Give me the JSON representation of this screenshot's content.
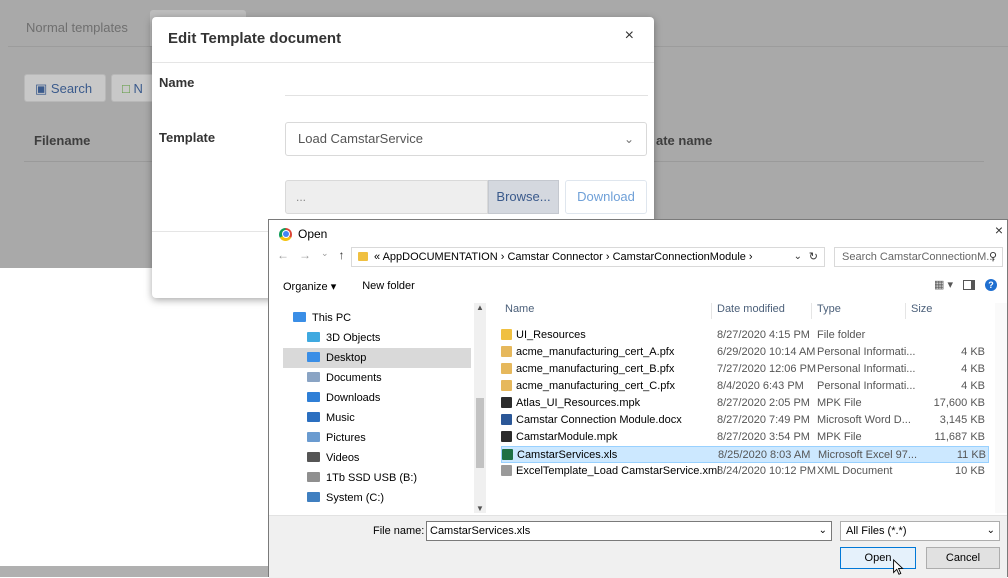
{
  "background": {
    "tabs": [
      "Normal templates",
      ""
    ],
    "search_label": "Search",
    "new_label": "N",
    "col_filename": "Filename",
    "col_template_name": "ate name"
  },
  "modal": {
    "title": "Edit Template document",
    "close": "×",
    "name_label": "Name",
    "template_label": "Template",
    "template_value": "Load CamstarService",
    "file_placeholder": "...",
    "browse_label": "Browse...",
    "download_label": "Download"
  },
  "open_dialog": {
    "title": "Open",
    "close": "×",
    "path": "« AppDOCUMENTATION › Camstar Connector › CamstarConnectionModule ›",
    "search_placeholder": "Search CamstarConnectionM...",
    "organize_label": "Organize ▾",
    "new_folder_label": "New folder",
    "nav_items": [
      {
        "label": "This PC",
        "icon": "computer-icon",
        "color": "#3a8ee6"
      },
      {
        "label": "3D Objects",
        "icon": "cube-icon",
        "color": "#3fa9e0"
      },
      {
        "label": "Desktop",
        "icon": "desktop-icon",
        "color": "#3a8ee6"
      },
      {
        "label": "Documents",
        "icon": "documents-icon",
        "color": "#8aa4c4"
      },
      {
        "label": "Downloads",
        "icon": "download-icon",
        "color": "#2f7fd6"
      },
      {
        "label": "Music",
        "icon": "music-icon",
        "color": "#2b6fc0"
      },
      {
        "label": "Pictures",
        "icon": "pictures-icon",
        "color": "#6a9bd0"
      },
      {
        "label": "Videos",
        "icon": "videos-icon",
        "color": "#555555"
      },
      {
        "label": "1Tb SSD USB (B:)",
        "icon": "drive-icon",
        "color": "#8f8f8f"
      },
      {
        "label": "System (C:)",
        "icon": "system-drive-icon",
        "color": "#3f7fc0"
      }
    ],
    "columns": {
      "name": "Name",
      "date": "Date modified",
      "type": "Type",
      "size": "Size"
    },
    "files": [
      {
        "name": "UI_Resources",
        "date": "8/27/2020 4:15 PM",
        "type": "File folder",
        "size": "",
        "icon": "folder-icon",
        "color": "#f0c040"
      },
      {
        "name": "acme_manufacturing_cert_A.pfx",
        "date": "6/29/2020 10:14 AM",
        "type": "Personal Informati...",
        "size": "4 KB",
        "icon": "certificate-icon",
        "color": "#e6b85c"
      },
      {
        "name": "acme_manufacturing_cert_B.pfx",
        "date": "7/27/2020 12:06 PM",
        "type": "Personal Informati...",
        "size": "4 KB",
        "icon": "certificate-icon",
        "color": "#e6b85c"
      },
      {
        "name": "acme_manufacturing_cert_C.pfx",
        "date": "8/4/2020 6:43 PM",
        "type": "Personal Informati...",
        "size": "4 KB",
        "icon": "certificate-icon",
        "color": "#e6b85c"
      },
      {
        "name": "Atlas_UI_Resources.mpk",
        "date": "8/27/2020 2:05 PM",
        "type": "MPK File",
        "size": "17,600 KB",
        "icon": "mpk-file-icon",
        "color": "#2b2b2b"
      },
      {
        "name": "Camstar Connection Module.docx",
        "date": "8/27/2020 7:49 PM",
        "type": "Microsoft Word D...",
        "size": "3,145 KB",
        "icon": "word-icon",
        "color": "#2b5797"
      },
      {
        "name": "CamstarModule.mpk",
        "date": "8/27/2020 3:54 PM",
        "type": "MPK File",
        "size": "11,687 KB",
        "icon": "mpk-file-icon",
        "color": "#2b2b2b"
      },
      {
        "name": "CamstarServices.xls",
        "date": "8/25/2020 8:03 AM",
        "type": "Microsoft Excel 97...",
        "size": "11 KB",
        "icon": "excel-icon",
        "color": "#1d7044"
      },
      {
        "name": "ExcelTemplate_Load CamstarService.xml",
        "date": "8/24/2020 10:12 PM",
        "type": "XML Document",
        "size": "10 KB",
        "icon": "xml-file-icon",
        "color": "#9a9a9a"
      }
    ],
    "file_name_label": "File name:",
    "file_name_value": "CamstarServices.xls",
    "file_type_value": "All Files (*.*)",
    "open_label": "Open",
    "cancel_label": "Cancel"
  }
}
